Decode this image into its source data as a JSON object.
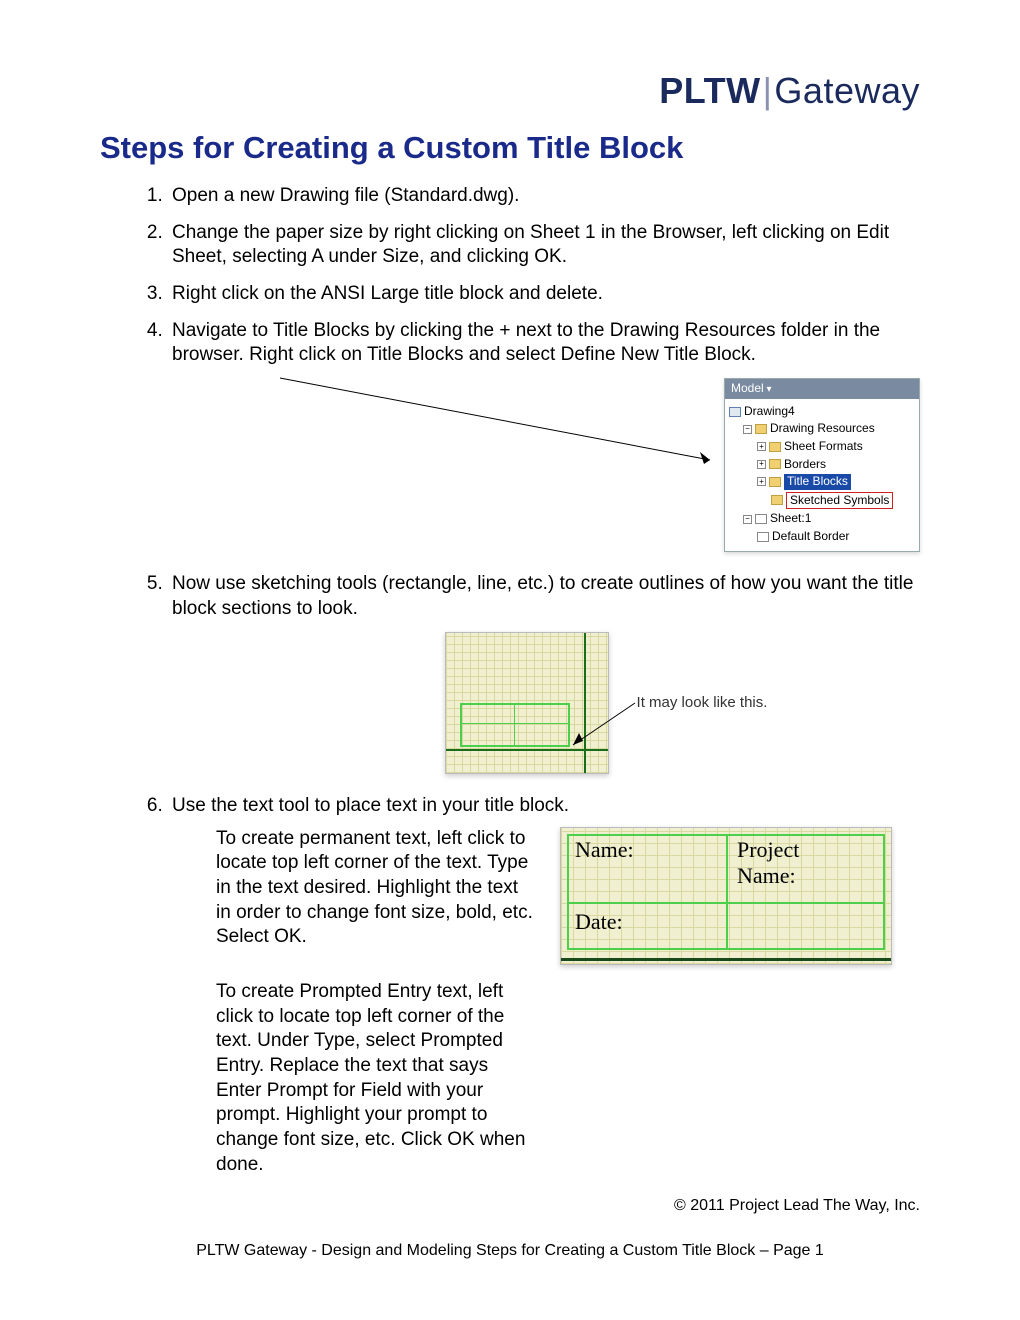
{
  "brand": {
    "left": "PLTW",
    "right": "Gateway"
  },
  "title": "Steps for Creating a Custom Title Block",
  "steps": {
    "s1": "Open a new Drawing file (Standard.dwg).",
    "s2": "Change the paper size by right clicking on Sheet 1 in the Browser, left clicking on Edit Sheet, selecting A under Size, and clicking OK.",
    "s3": "Right click on the ANSI Large title block and delete.",
    "s4": "Navigate to Title Blocks by clicking the + next to the Drawing Resources folder in the browser. Right click on Title Blocks and select Define New Title Block.",
    "s5": "Now use sketching tools (rectangle, line, etc.) to create outlines of how you want the title block sections to look.",
    "s6": "Use the text tool to place text in your title block."
  },
  "tree": {
    "title": "Model",
    "n0": "Drawing4",
    "n1": "Drawing Resources",
    "n2": "Sheet Formats",
    "n3": "Borders",
    "n4": "Title Blocks",
    "n5": "Sketched Symbols",
    "n6": "Sheet:1",
    "n7": "Default Border"
  },
  "caption5": "It may look like this.",
  "step6": {
    "p1": "To create permanent text, left click to locate top left corner of the text. Type in the text desired. Highlight the text in order to change font size, bold, etc. Select OK.",
    "p2": "To create Prompted Entry text, left click to locate top left corner of the text. Under Type, select Prompted Entry. Replace the text that says Enter Prompt for Field with your prompt. Highlight your prompt to change font size, etc. Click OK when done."
  },
  "tb": {
    "name": "Name:",
    "project1": "Project",
    "project2": "Name:",
    "date": "Date:"
  },
  "copyright": "© 2011 Project Lead The Way, Inc.",
  "footer": "PLTW Gateway - Design and Modeling Steps for Creating a Custom Title Block  – Page 1"
}
